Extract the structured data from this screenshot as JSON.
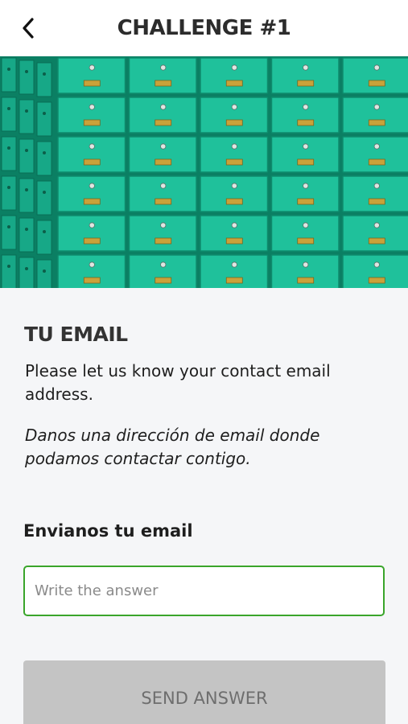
{
  "header": {
    "title": "CHALLENGE #1",
    "back_icon": "chevron-left-icon"
  },
  "hero": {
    "description_icon": "safe-deposit-boxes-image",
    "colors": {
      "box": "#1fc19b",
      "shadow": "#0b7f63",
      "brass": "#c9a23a"
    }
  },
  "section": {
    "title": "TU EMAIL",
    "description_en": "Please let us know your contact email address.",
    "description_es": "Danos una dirección de email donde podamos contactar contigo."
  },
  "form": {
    "label": "Envianos tu email",
    "input_placeholder": "Write the answer",
    "input_value": "",
    "submit_label": "SEND ANSWER"
  },
  "colors": {
    "accent_green": "#3aa52b",
    "disabled_button": "#c4c4c4",
    "background": "#f5f6f8"
  }
}
